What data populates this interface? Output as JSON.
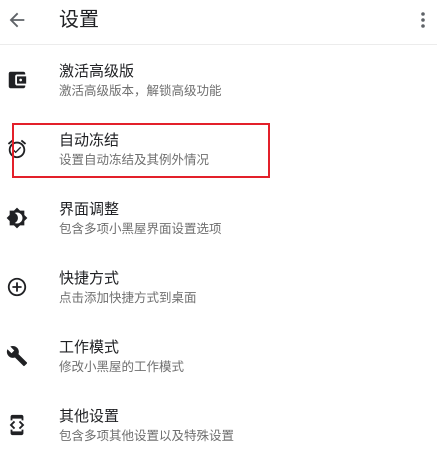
{
  "appbar": {
    "title": "设置",
    "back_icon": "arrow-left-icon",
    "more_icon": "more-vert-icon"
  },
  "settings": [
    {
      "title": "激活高级版",
      "subtitle": "激活高级版本，解锁高级功能",
      "icon": "wallet-icon"
    },
    {
      "title": "自动冻结",
      "subtitle": "设置自动冻结及其例外情况",
      "icon": "alarm-check-icon"
    },
    {
      "title": "界面调整",
      "subtitle": "包含多项小黑屋界面设置选项",
      "icon": "brightness-icon"
    },
    {
      "title": "快捷方式",
      "subtitle": "点击添加快捷方式到桌面",
      "icon": "add-circle-icon"
    },
    {
      "title": "工作模式",
      "subtitle": "修改小黑屋的工作模式",
      "icon": "wrench-icon"
    },
    {
      "title": "其他设置",
      "subtitle": "包含多项其他设置以及特殊设置",
      "icon": "developer-mode-icon"
    }
  ],
  "colors": {
    "highlight": "#e3202a",
    "icon": "#202124",
    "subtitle": "#6f6f6f"
  }
}
